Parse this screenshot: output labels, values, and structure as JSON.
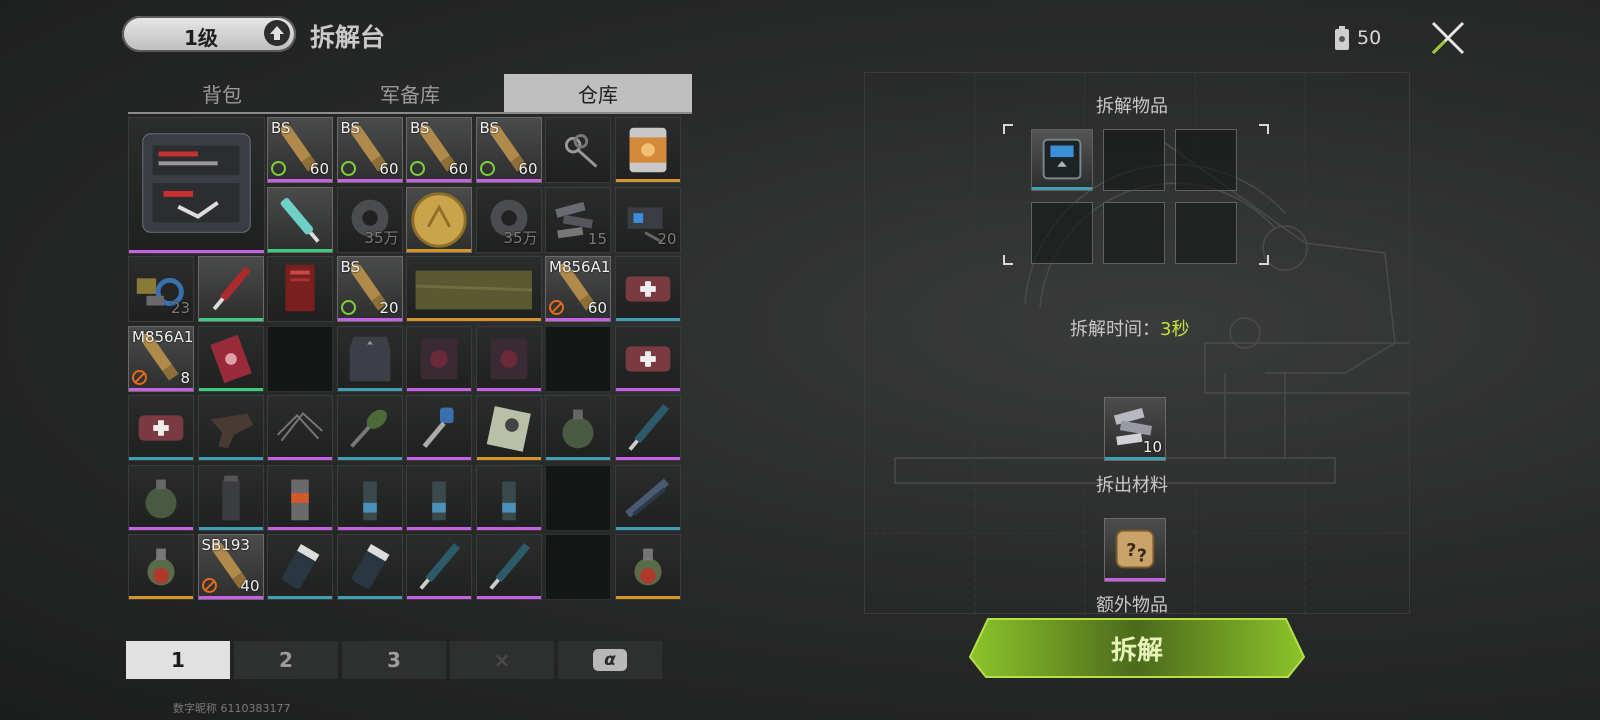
{
  "header": {
    "level": "1级",
    "title": "拆解台",
    "energy": "50"
  },
  "tabs": [
    {
      "label": "背包",
      "active": false
    },
    {
      "label": "军备库",
      "active": false
    },
    {
      "label": "仓库",
      "active": true
    }
  ],
  "colors": {
    "purple": "#c561e2",
    "green": "#3fcb7d",
    "orange": "#d8942b",
    "blue": "#3e9fb4",
    "accent": "#9acb2e",
    "time": "#c4e33c"
  },
  "items": [
    {
      "row": 0,
      "col": 0,
      "size": "big",
      "icon": "tool-case-icon",
      "rarity": "purple"
    },
    {
      "row": 0,
      "col": 2,
      "icon": "bullet-icon",
      "label": "BS",
      "count": "60",
      "mark": "ring",
      "rarity": "purple",
      "hl": true
    },
    {
      "row": 0,
      "col": 3,
      "icon": "bullet-icon",
      "label": "BS",
      "count": "60",
      "mark": "ring",
      "rarity": "purple",
      "hl": true
    },
    {
      "row": 0,
      "col": 4,
      "icon": "bullet-icon",
      "label": "BS",
      "count": "60",
      "mark": "ring",
      "rarity": "purple",
      "hl": true
    },
    {
      "row": 0,
      "col": 5,
      "icon": "bullet-icon",
      "label": "BS",
      "count": "60",
      "mark": "ring",
      "rarity": "purple",
      "hl": true
    },
    {
      "row": 0,
      "col": 6,
      "icon": "keys-icon"
    },
    {
      "row": 0,
      "col": 7,
      "icon": "food-can-icon",
      "rarity": "orange"
    },
    {
      "row": 1,
      "col": 2,
      "icon": "syringe-icon",
      "rarity": "green",
      "hl": true
    },
    {
      "row": 1,
      "col": 3,
      "icon": "tape-roll-icon",
      "count": "35万",
      "dim": true
    },
    {
      "row": 1,
      "col": 4,
      "icon": "gold-coin-icon",
      "rarity": "orange",
      "hl": true
    },
    {
      "row": 1,
      "col": 5,
      "icon": "tape-roll-icon",
      "count": "35万",
      "dim": true
    },
    {
      "row": 1,
      "col": 6,
      "icon": "scrap-metal-icon",
      "count": "15",
      "dim": true
    },
    {
      "row": 1,
      "col": 7,
      "icon": "electronic-parts-icon",
      "count": "20",
      "dim": true
    },
    {
      "row": 2,
      "col": 0,
      "icon": "parts-pile-icon",
      "count": "23",
      "dim": true
    },
    {
      "row": 2,
      "col": 1,
      "icon": "stim-pen-icon",
      "rarity": "green",
      "hl": true
    },
    {
      "row": 2,
      "col": 2,
      "icon": "red-document-icon"
    },
    {
      "row": 2,
      "col": 3,
      "icon": "bullet-icon",
      "label": "BS",
      "count": "20",
      "mark": "ring",
      "rarity": "purple",
      "hl": true
    },
    {
      "row": 2,
      "col": 4,
      "w": 2,
      "icon": "tarp-icon",
      "rarity": "orange"
    },
    {
      "row": 2,
      "col": 6,
      "icon": "bullet-icon",
      "label": "M856A1",
      "count": "60",
      "mark": "ban",
      "rarity": "purple",
      "hl": true
    },
    {
      "row": 2,
      "col": 7,
      "icon": "medkit-icon",
      "rarity": "blue"
    },
    {
      "row": 3,
      "col": 0,
      "icon": "bullet-icon",
      "label": "M856A1",
      "count": "8",
      "mark": "ban",
      "rarity": "purple",
      "hl": true
    },
    {
      "row": 3,
      "col": 1,
      "icon": "playing-card-icon",
      "rarity": "green"
    },
    {
      "row": 3,
      "col": 2,
      "empty": true
    },
    {
      "row": 3,
      "col": 3,
      "icon": "armor-plate-icon",
      "rarity": "blue"
    },
    {
      "row": 3,
      "col": 4,
      "icon": "chip-pack-icon",
      "rarity": "purple"
    },
    {
      "row": 3,
      "col": 5,
      "icon": "chip-pack-icon",
      "rarity": "purple"
    },
    {
      "row": 3,
      "col": 6,
      "empty": true
    },
    {
      "row": 3,
      "col": 7,
      "icon": "medkit-icon",
      "rarity": "purple"
    },
    {
      "row": 4,
      "col": 0,
      "icon": "medkit-icon",
      "rarity": "blue"
    },
    {
      "row": 4,
      "col": 1,
      "icon": "holster-icon",
      "rarity": "blue"
    },
    {
      "row": 4,
      "col": 2,
      "icon": "wires-icon",
      "rarity": "purple"
    },
    {
      "row": 4,
      "col": 3,
      "icon": "leaf-tool-icon",
      "rarity": "blue"
    },
    {
      "row": 4,
      "col": 4,
      "icon": "key-icon",
      "rarity": "purple"
    },
    {
      "row": 4,
      "col": 5,
      "icon": "id-card-icon",
      "rarity": "orange"
    },
    {
      "row": 4,
      "col": 6,
      "icon": "grenade-icon",
      "rarity": "blue"
    },
    {
      "row": 4,
      "col": 7,
      "icon": "injector-icon",
      "rarity": "purple"
    },
    {
      "row": 5,
      "col": 0,
      "icon": "grenade-icon",
      "rarity": "purple"
    },
    {
      "row": 5,
      "col": 1,
      "icon": "smoke-grenade-icon",
      "rarity": "blue"
    },
    {
      "row": 5,
      "col": 2,
      "icon": "flashbang-icon",
      "rarity": "purple"
    },
    {
      "row": 5,
      "col": 3,
      "icon": "stun-grenade-icon",
      "rarity": "purple"
    },
    {
      "row": 5,
      "col": 4,
      "icon": "stun-grenade-icon",
      "rarity": "purple"
    },
    {
      "row": 5,
      "col": 5,
      "icon": "stun-grenade-icon",
      "rarity": "purple"
    },
    {
      "row": 5,
      "col": 6,
      "empty": true
    },
    {
      "row": 5,
      "col": 7,
      "icon": "weapon-part-icon",
      "rarity": "blue"
    },
    {
      "row": 6,
      "col": 0,
      "icon": "frag-grenade-icon",
      "rarity": "orange"
    },
    {
      "row": 6,
      "col": 1,
      "icon": "bullet-icon",
      "label": "SB193",
      "count": "40",
      "mark": "ban",
      "rarity": "purple",
      "hl": true
    },
    {
      "row": 6,
      "col": 2,
      "icon": "pill-bottle-icon",
      "rarity": "blue"
    },
    {
      "row": 6,
      "col": 3,
      "icon": "pill-bottle-icon",
      "rarity": "blue"
    },
    {
      "row": 6,
      "col": 4,
      "icon": "injector-icon",
      "rarity": "purple"
    },
    {
      "row": 6,
      "col": 5,
      "icon": "injector-icon",
      "rarity": "purple"
    },
    {
      "row": 6,
      "col": 6,
      "empty": true
    },
    {
      "row": 6,
      "col": 7,
      "icon": "frag-grenade-icon",
      "rarity": "orange"
    }
  ],
  "pages": [
    {
      "label": "1",
      "active": true
    },
    {
      "label": "2"
    },
    {
      "label": "3"
    },
    {
      "label": "×",
      "disabled": true
    },
    {
      "label": "α",
      "special": true
    }
  ],
  "uid": "数字昵称 6110383177",
  "dismantle": {
    "items_title": "拆解物品",
    "slots": [
      {
        "filled": true,
        "icon": "supply-box-icon",
        "rarity": "blue"
      },
      {
        "filled": false
      },
      {
        "filled": false
      },
      {
        "filled": false
      },
      {
        "filled": false
      },
      {
        "filled": false
      }
    ],
    "time_label": "拆解时间：",
    "time_value": "3秒",
    "material_title": "拆出材料",
    "material_count": "10",
    "extra_title": "额外物品",
    "confirm_label": "拆解"
  }
}
